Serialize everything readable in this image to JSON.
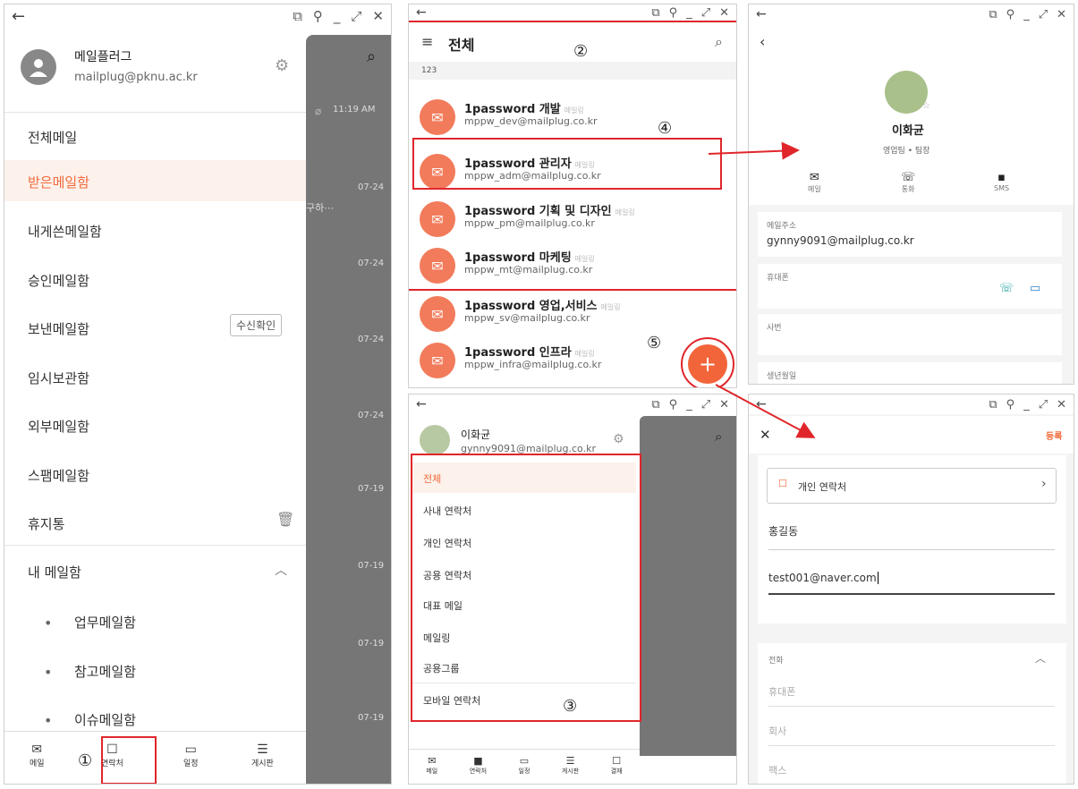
{
  "colors": {
    "accent": "#f27b5b",
    "highlight_box": "#e0262b",
    "link_orange": "#f26b3a"
  },
  "window_controls": {
    "back": "←",
    "restore": "⧉",
    "pin": "⚲",
    "minimize": "_",
    "maximize": "⤢",
    "close": "✕"
  },
  "annotations": {
    "n1": "①",
    "n2": "②",
    "n3": "③",
    "n4": "④",
    "n5": "⑤"
  },
  "panel1": {
    "user_name": "메일플러그",
    "user_email": "mailplug@pknu.ac.kr",
    "menu": [
      "전체메일",
      "받은메일함",
      "내게쓴메일함",
      "승인메일함",
      "보낸메일함",
      "임시보관함",
      "외부메일함",
      "스팸메일함",
      "휴지통"
    ],
    "receipt_button": "수신확인",
    "my_mailbox": "내 메일함",
    "sub_folders": [
      "업무메일함",
      "참고메일함",
      "이슈메일함"
    ],
    "bullet": "•",
    "bg_times": [
      "11:19 AM",
      "07-24",
      "07-24",
      "07-24",
      "07-24",
      "07-19",
      "07-19",
      "07-19",
      "07-19"
    ],
    "bg_snippet": "구하⋯",
    "nav": [
      "메일",
      "연락처",
      "일정",
      "게시판"
    ]
  },
  "panel2": {
    "title": "전체",
    "section": "123",
    "tag": "메일링",
    "contacts": [
      {
        "name": "1password 개발",
        "email": "mppw_dev@mailplug.co.kr"
      },
      {
        "name": "1password 관리자",
        "email": "mppw_adm@mailplug.co.kr"
      },
      {
        "name": "1password 기획 및 디자인",
        "email": "mppw_pm@mailplug.co.kr"
      },
      {
        "name": "1password 마케팅",
        "email": "mppw_mt@mailplug.co.kr"
      },
      {
        "name": "1password 영업,서비스",
        "email": "mppw_sv@mailplug.co.kr"
      },
      {
        "name": "1password 인프라",
        "email": "mppw_infra@mailplug.co.kr"
      }
    ],
    "fab": "+"
  },
  "panel3": {
    "user_name": "이화균",
    "user_email": "gynny9091@mailplug.co.kr",
    "menu": [
      "전체",
      "사내 연락처",
      "개인 연락처",
      "공용 연락처",
      "대표 메일",
      "메일링",
      "공용그룹",
      "모바일 연락처"
    ],
    "nav": [
      "메일",
      "연락처",
      "일정",
      "게시판",
      "결재"
    ]
  },
  "panel4": {
    "name": "이화균",
    "dept": "영업팀 • 팀장",
    "actions": [
      "메일",
      "통화",
      "SMS"
    ],
    "email_label": "메일주소",
    "email_value": "gynny9091@mailplug.co.kr",
    "phone_label": "휴대폰",
    "emp_label": "사번",
    "birth_label": "생년월일"
  },
  "panel5": {
    "register": "등록",
    "addressbook": "개인 연락처",
    "name_value": "홍길동",
    "email_value": "test001@naver.com",
    "phone_section": "전화",
    "fields": [
      "휴대폰",
      "회사",
      "팩스"
    ]
  }
}
